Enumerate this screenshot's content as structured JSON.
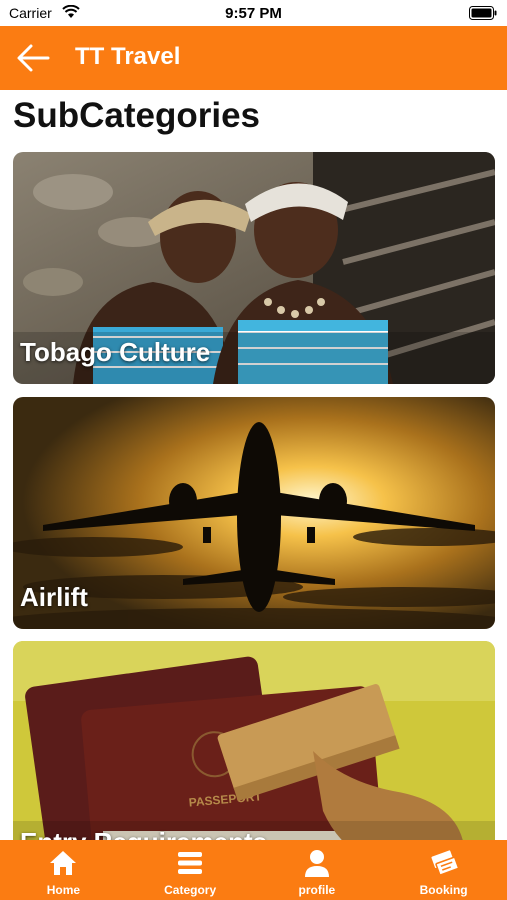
{
  "status_bar": {
    "carrier": "Carrier",
    "time": "9:57 PM"
  },
  "app_bar": {
    "title": "TT Travel"
  },
  "page": {
    "title": "SubCategories"
  },
  "subcategories": [
    {
      "label": "Tobago Culture"
    },
    {
      "label": "Airlift"
    },
    {
      "label": "Entry Requirements"
    }
  ],
  "bottom_nav": [
    {
      "label": "Home",
      "icon": "home-icon"
    },
    {
      "label": "Category",
      "icon": "list-icon"
    },
    {
      "label": "profile",
      "icon": "person-icon"
    },
    {
      "label": "Booking",
      "icon": "tickets-icon"
    }
  ],
  "colors": {
    "accent": "#fb7c12"
  }
}
